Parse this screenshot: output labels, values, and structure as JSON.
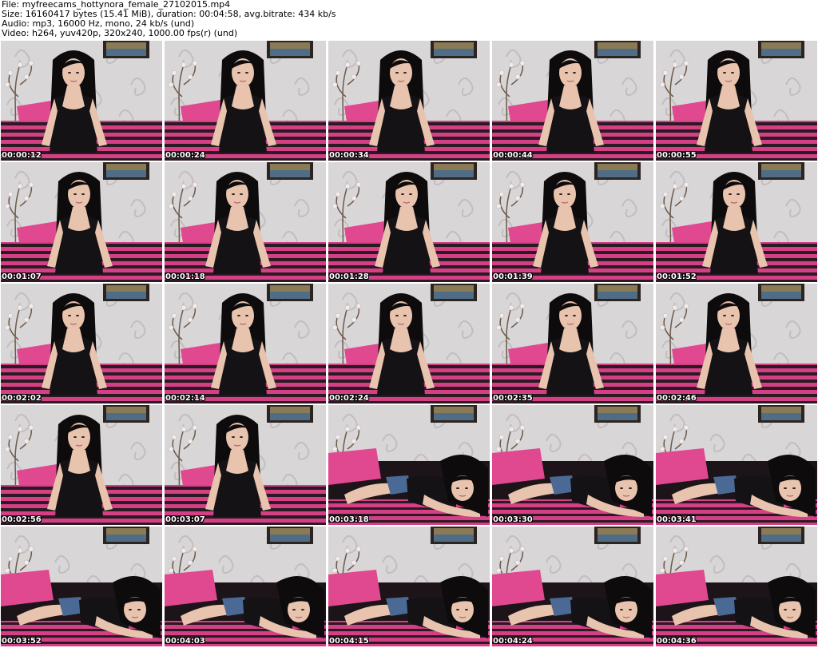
{
  "info": {
    "file_line": "File: myfreecams_hottynora_female_27102015.mp4",
    "size_line": "Size: 16160417 bytes (15.41 MiB), duration: 00:04:58, avg.bitrate: 434 kb/s",
    "audio_line": "Audio: mp3, 16000 Hz, mono, 24 kb/s (und)",
    "video_line": "Video: h264, yuv420p, 320x240, 1000.00 fps(r) (und)"
  },
  "colors": {
    "wall": "#d9d6d8",
    "wall_pattern": "#b9b3b6",
    "pillow": "#e0488f",
    "bed_stripe_dark": "#2a1a22",
    "bed_stripe_pink": "#d43f86",
    "hair": "#0d0b0c",
    "skin": "#e8c3ad",
    "top": "#141214",
    "frame": "#2c2420",
    "shorts": "#4a6a95"
  },
  "thumbnails": [
    {
      "timestamp": "00:00:12",
      "pose": "sit"
    },
    {
      "timestamp": "00:00:24",
      "pose": "sit"
    },
    {
      "timestamp": "00:00:34",
      "pose": "sit"
    },
    {
      "timestamp": "00:00:44",
      "pose": "sit"
    },
    {
      "timestamp": "00:00:55",
      "pose": "sit"
    },
    {
      "timestamp": "00:01:07",
      "pose": "sit"
    },
    {
      "timestamp": "00:01:18",
      "pose": "sit"
    },
    {
      "timestamp": "00:01:28",
      "pose": "sit"
    },
    {
      "timestamp": "00:01:39",
      "pose": "sit"
    },
    {
      "timestamp": "00:01:52",
      "pose": "sit"
    },
    {
      "timestamp": "00:02:02",
      "pose": "sit"
    },
    {
      "timestamp": "00:02:14",
      "pose": "sit"
    },
    {
      "timestamp": "00:02:24",
      "pose": "sit"
    },
    {
      "timestamp": "00:02:35",
      "pose": "sit"
    },
    {
      "timestamp": "00:02:46",
      "pose": "sit"
    },
    {
      "timestamp": "00:02:56",
      "pose": "sit"
    },
    {
      "timestamp": "00:03:07",
      "pose": "sit"
    },
    {
      "timestamp": "00:03:18",
      "pose": "lie"
    },
    {
      "timestamp": "00:03:30",
      "pose": "lie"
    },
    {
      "timestamp": "00:03:41",
      "pose": "lie"
    },
    {
      "timestamp": "00:03:52",
      "pose": "lie"
    },
    {
      "timestamp": "00:04:03",
      "pose": "lie"
    },
    {
      "timestamp": "00:04:15",
      "pose": "lie"
    },
    {
      "timestamp": "00:04:24",
      "pose": "lie"
    },
    {
      "timestamp": "00:04:36",
      "pose": "lie"
    }
  ]
}
